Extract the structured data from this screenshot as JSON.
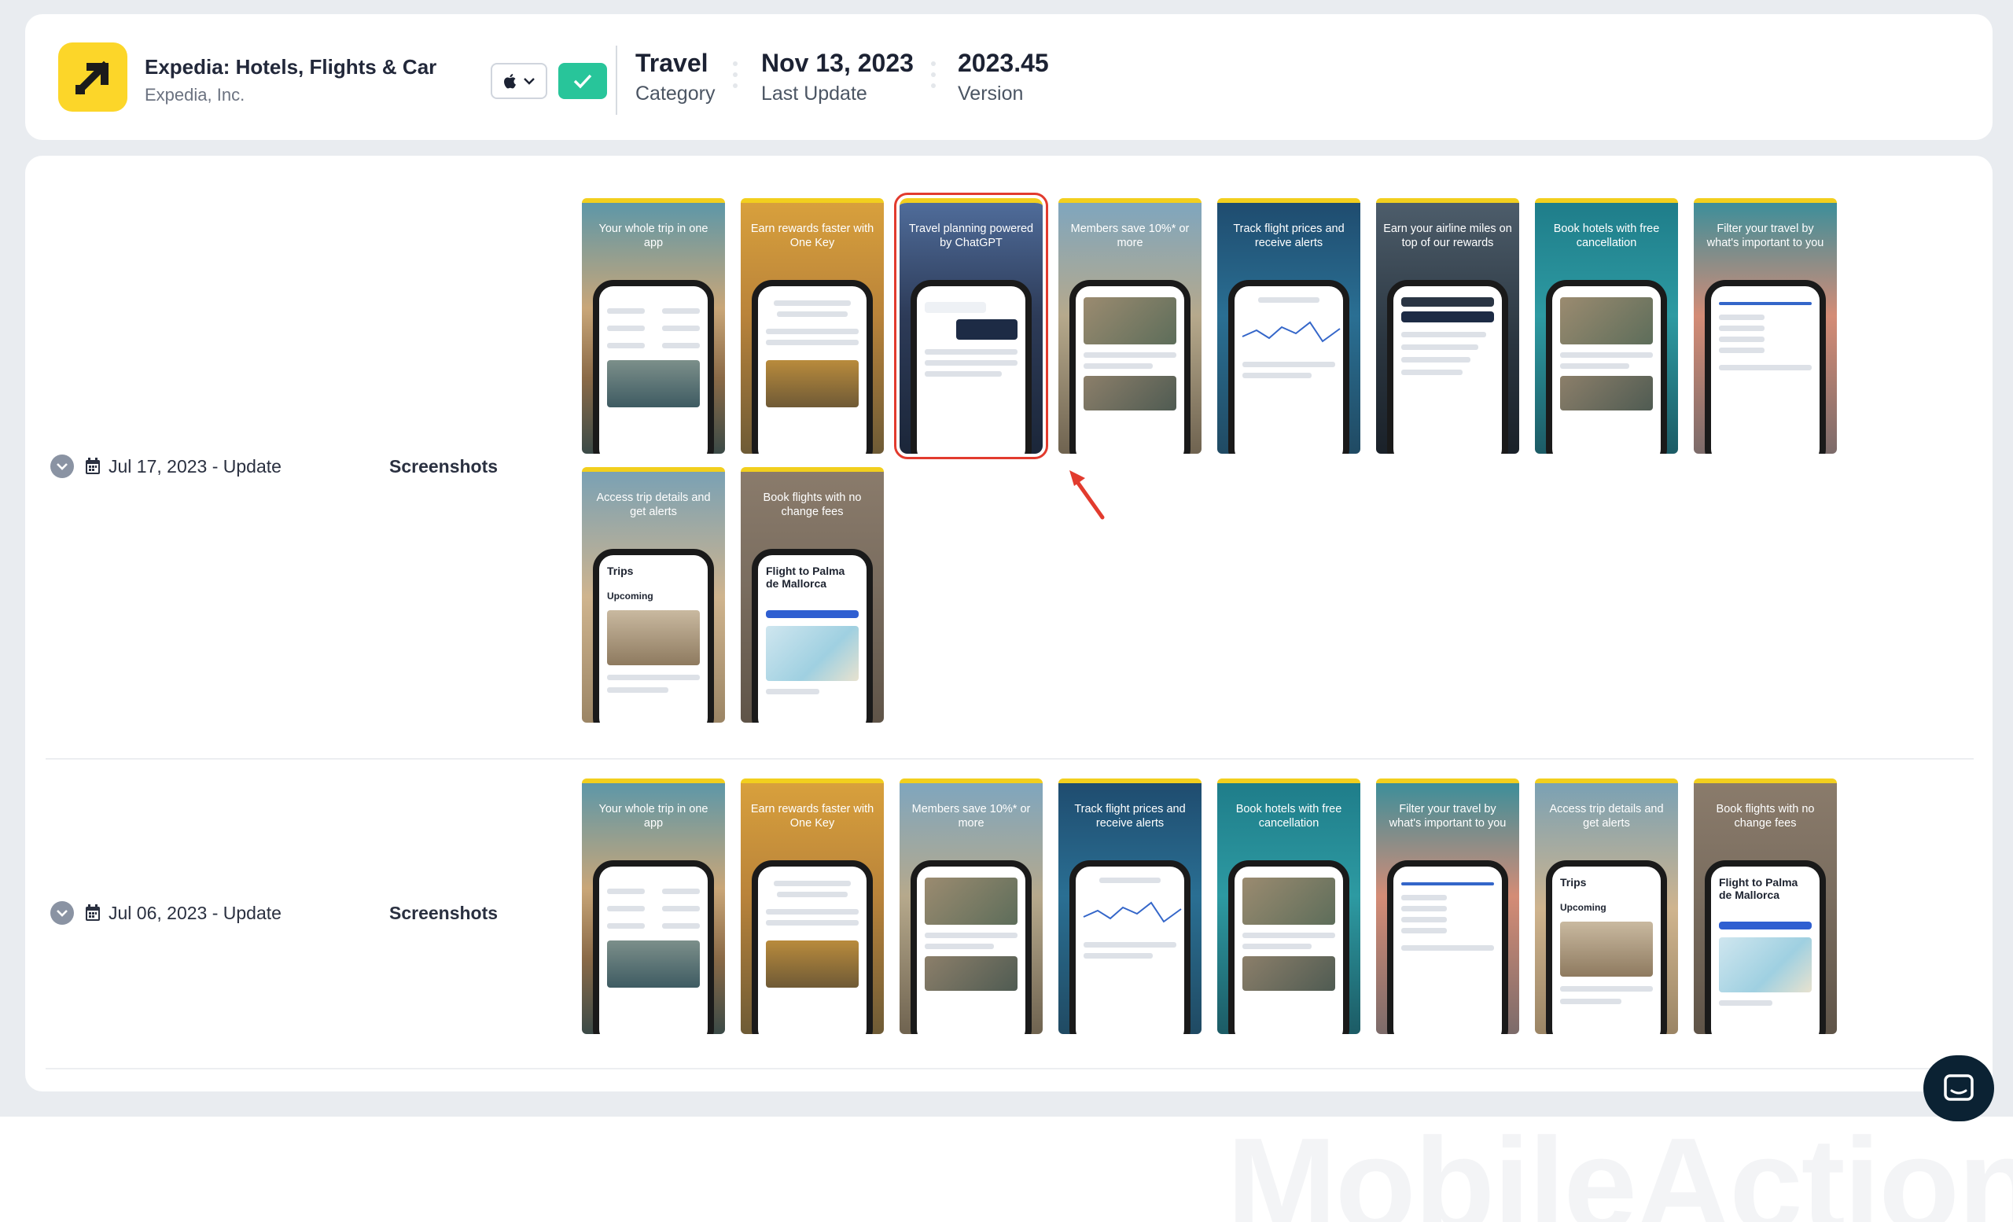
{
  "app": {
    "name": "Expedia: Hotels, Flights & Car",
    "developer": "Expedia, Inc.",
    "icon": "expedia-arrow-icon",
    "brand_color": "#fcd629"
  },
  "header": {
    "platform_icon": "apple-icon",
    "status_icon": "check-icon",
    "category": {
      "value": "Travel",
      "label": "Category"
    },
    "last_update": {
      "value": "Nov 13, 2023",
      "label": "Last Update"
    },
    "version": {
      "value": "2023.45",
      "label": "Version"
    }
  },
  "updates": [
    {
      "date": "Jul 17, 2023 - Update",
      "kind": "Screenshots",
      "screenshots": [
        {
          "caption": "Your whole trip in one app",
          "theme": "desert",
          "screen": "menu"
        },
        {
          "caption": "Earn rewards faster with One Key",
          "theme": "gold",
          "screen": "rewards"
        },
        {
          "caption": "Travel planning powered by ChatGPT",
          "theme": "palms",
          "screen": "chat",
          "highlighted": true
        },
        {
          "caption": "Members save 10%* or more",
          "theme": "cactus",
          "screen": "hotel"
        },
        {
          "caption": "Track flight prices and receive alerts",
          "theme": "ocean",
          "screen": "price"
        },
        {
          "caption": "Earn your airline miles on top of our rewards",
          "theme": "dark",
          "screen": "account"
        },
        {
          "caption": "Book hotels with free cancellation",
          "theme": "teal",
          "screen": "hotel"
        },
        {
          "caption": "Filter your travel by what's important to you",
          "theme": "coast",
          "screen": "filter"
        },
        {
          "caption": "Access trip details and get alerts",
          "theme": "beach",
          "screen": "trips",
          "phone_title": "Trips",
          "phone_sub": "Upcoming"
        },
        {
          "caption": "Book flights with no change fees",
          "theme": "stone",
          "screen": "flight",
          "phone_title": "Flight to Palma de Mallorca"
        }
      ]
    },
    {
      "date": "Jul 06, 2023 - Update",
      "kind": "Screenshots",
      "screenshots": [
        {
          "caption": "Your whole trip in one app",
          "theme": "desert",
          "screen": "menu"
        },
        {
          "caption": "Earn rewards faster with One Key",
          "theme": "gold",
          "screen": "rewards"
        },
        {
          "caption": "Members save 10%* or more",
          "theme": "cactus",
          "screen": "hotel"
        },
        {
          "caption": "Track flight prices and receive alerts",
          "theme": "ocean",
          "screen": "price"
        },
        {
          "caption": "Book hotels with free cancellation",
          "theme": "teal",
          "screen": "hotel"
        },
        {
          "caption": "Filter your travel by what's important to you",
          "theme": "coast",
          "screen": "filter"
        },
        {
          "caption": "Access trip details and get alerts",
          "theme": "beach",
          "screen": "trips",
          "phone_title": "Trips",
          "phone_sub": "Upcoming"
        },
        {
          "caption": "Book flights with no change fees",
          "theme": "stone",
          "screen": "flight",
          "phone_title": "Flight to Palma de Mallorca"
        }
      ]
    }
  ],
  "chat_icon": "chat-icon",
  "watermark": "MobileAction",
  "colors": {
    "accent_green": "#28c59a",
    "highlight_red": "#e23b2e",
    "screenshot_top": "#f2cf1e"
  }
}
